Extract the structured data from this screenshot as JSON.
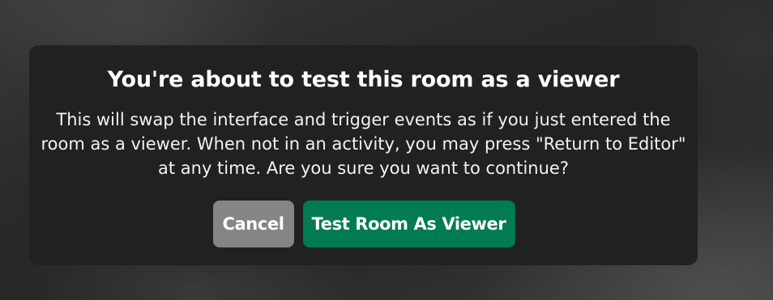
{
  "dialog": {
    "title": "You're about to test this room as a viewer",
    "message": "This will swap the interface and trigger events as if you just entered the room as a viewer. When not in an activity, you may press \"Return to Editor\" at any time. Are you sure you want to continue?",
    "buttons": {
      "cancel_label": "Cancel",
      "confirm_label": "Test Room As Viewer"
    }
  },
  "colors": {
    "dialog_background": "#212121",
    "cancel_button": "#858585",
    "confirm_button": "#017b52",
    "text": "#ffffff"
  }
}
